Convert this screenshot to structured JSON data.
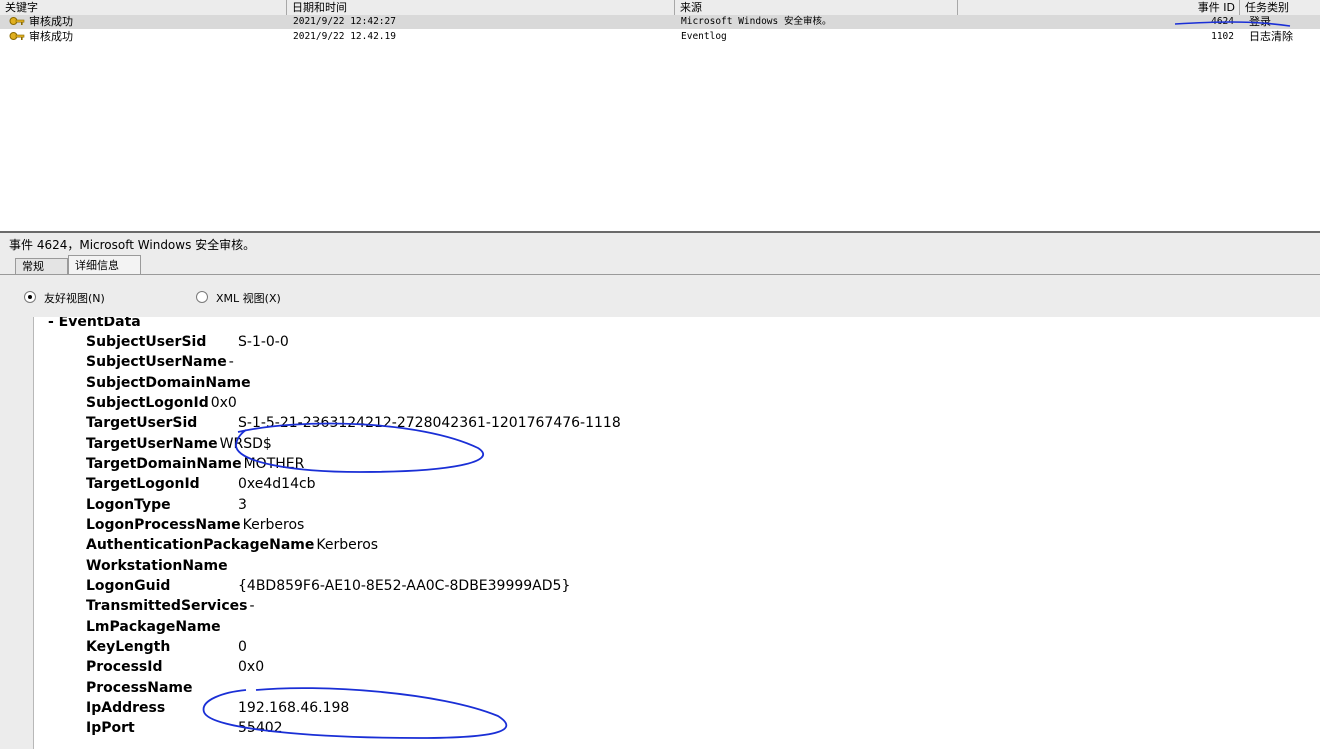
{
  "list": {
    "columns": [
      "关键字",
      "日期和时间",
      "来源",
      "事件 ID",
      "任务类别"
    ],
    "rows": [
      {
        "keyword": "审核成功",
        "datetime": "2021/9/22 12:42:27",
        "source": "Microsoft Windows 安全审核。",
        "event_id": "4624",
        "category": "登录"
      },
      {
        "keyword": "审核成功",
        "datetime": "2021/9/22 12.42.19",
        "source": "Eventlog",
        "event_id": "1102",
        "category": "日志清除"
      }
    ]
  },
  "detail": {
    "title": "事件 4624，Microsoft Windows 安全审核。",
    "tabs": [
      "常规",
      "详细信息"
    ],
    "view_friendly": "友好视图(N)",
    "view_xml": "XML 视图(X)",
    "section": "-  EventData",
    "fields": [
      {
        "name": "SubjectUserSid",
        "value": "S-1-0-0"
      },
      {
        "name": "SubjectUserName",
        "value": "-"
      },
      {
        "name": "SubjectDomainName",
        "value": ""
      },
      {
        "name": "SubjectLogonId",
        "value": "0x0"
      },
      {
        "name": "TargetUserSid",
        "value": "S-1-5-21-2363124212-2728042361-1201767476-1118"
      },
      {
        "name": "TargetUserName",
        "value": "WRSD$"
      },
      {
        "name": "TargetDomainName",
        "value": "MOTHER"
      },
      {
        "name": "TargetLogonId",
        "value": "0xe4d14cb"
      },
      {
        "name": "LogonType",
        "value": "3"
      },
      {
        "name": "LogonProcessName",
        "value": "Kerberos"
      },
      {
        "name": "AuthenticationPackageName",
        "value": "Kerberos"
      },
      {
        "name": "WorkstationName",
        "value": ""
      },
      {
        "name": "LogonGuid",
        "value": "{4BD859F6-AE10-8E52-AA0C-8DBE39999AD5}"
      },
      {
        "name": "TransmittedServices",
        "value": "-"
      },
      {
        "name": "LmPackageName",
        "value": ""
      },
      {
        "name": "KeyLength",
        "value": "0"
      },
      {
        "name": "ProcessId",
        "value": "0x0"
      },
      {
        "name": "ProcessName",
        "value": ""
      },
      {
        "name": "IpAddress",
        "value": "192.168.46.198"
      },
      {
        "name": "IpPort",
        "value": "55402"
      }
    ]
  },
  "colors": {
    "annotation": "#1a2fd6",
    "selected_row": "#d9d9d9",
    "pane_bg": "#ececec"
  },
  "icons": {
    "row": "key-icon",
    "annotation": "hand-drawn-circle"
  }
}
